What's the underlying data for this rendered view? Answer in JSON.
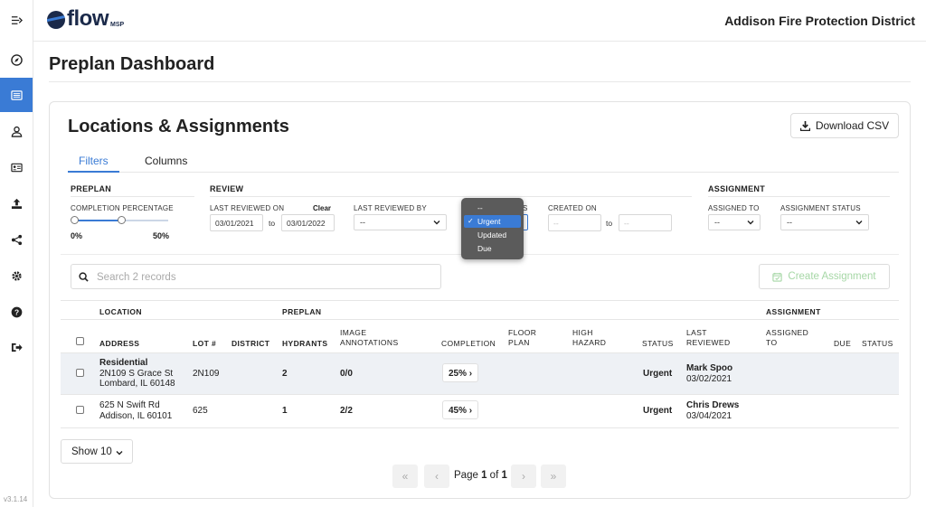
{
  "app": {
    "logo_text": "flow",
    "logo_sub": "MSP",
    "org_name": "Addison Fire Protection District",
    "version": "v3.1.14"
  },
  "sidebar": {
    "items": [
      {
        "icon": "collapse-icon"
      },
      {
        "icon": "compass-icon"
      },
      {
        "icon": "list-icon",
        "active": true
      },
      {
        "icon": "user-icon"
      },
      {
        "icon": "id-card-icon"
      },
      {
        "icon": "upload-icon"
      },
      {
        "icon": "share-icon"
      },
      {
        "icon": "gear-icon"
      },
      {
        "icon": "help-icon"
      },
      {
        "icon": "logout-icon"
      }
    ]
  },
  "page": {
    "title": "Preplan Dashboard"
  },
  "card": {
    "title": "Locations & Assignments",
    "download_label": "Download CSV",
    "tabs": [
      {
        "label": "Filters",
        "active": true
      },
      {
        "label": "Columns",
        "active": false
      }
    ]
  },
  "filters": {
    "preplan": {
      "heading": "PREPLAN",
      "completion_label": "COMPLETION PERCENTAGE",
      "completion_min": "0%",
      "completion_max": "50%",
      "completion_min_value": 0,
      "completion_max_value": 50
    },
    "review": {
      "heading": "REVIEW",
      "last_reviewed_on_label": "LAST REVIEWED ON",
      "clear_label": "Clear",
      "from_date": "03/01/2021",
      "to_label": "to",
      "to_date": "03/01/2022",
      "last_reviewed_by_label": "LAST REVIEWED BY",
      "last_reviewed_by_value": "--",
      "status_label_fragment": "S",
      "created_on_label": "CREATED ON",
      "created_from": "--",
      "created_to": "--"
    },
    "assignment": {
      "heading": "ASSIGNMENT",
      "assigned_to_label": "ASSIGNED TO",
      "assigned_to_value": "--",
      "assignment_status_label": "ASSIGNMENT STATUS",
      "assignment_status_value": "--"
    },
    "status_menu": {
      "options": [
        "--",
        "Urgent",
        "Updated",
        "Due"
      ],
      "selected": "Urgent",
      "check": "✓"
    }
  },
  "toolbar": {
    "search_placeholder": "Search 2 records",
    "create_label": "Create Assignment"
  },
  "table": {
    "groups": {
      "location": "LOCATION",
      "preplan": "PREPLAN",
      "assignment": "ASSIGNMENT"
    },
    "headers": {
      "address": "ADDRESS",
      "lot": "LOT #",
      "district": "DISTRICT",
      "hydrants": "HYDRANTS",
      "image_annotations": [
        "IMAGE",
        "ANNOTATIONS"
      ],
      "completion": "COMPLETION",
      "floor_plan": [
        "FLOOR",
        "PLAN"
      ],
      "high_hazard": [
        "HIGH",
        "HAZARD"
      ],
      "status": "STATUS",
      "last_reviewed": [
        "LAST",
        "REVIEWED"
      ],
      "assigned_to": [
        "ASSIGNED",
        "TO"
      ],
      "due": "DUE",
      "assignment_status": "STATUS"
    },
    "rows": [
      {
        "address_name": "Residential",
        "address_line1": "2N109 S Grace St",
        "address_line2": "Lombard, IL 60148",
        "lot": "2N109",
        "hydrants": "2",
        "image_annotations": "0/0",
        "completion": "25%",
        "status": "Urgent",
        "reviewer": "Mark Spoo",
        "reviewed_date": "03/02/2021"
      },
      {
        "address_line1": "625 N Swift Rd",
        "address_line2": "Addison, IL 60101",
        "lot": "625",
        "hydrants": "1",
        "image_annotations": "2/2",
        "completion": "45%",
        "status": "Urgent",
        "reviewer": "Chris Drews",
        "reviewed_date": "03/04/2021"
      }
    ]
  },
  "pagination": {
    "show_label": "Show 10",
    "page_word": "Page",
    "current": "1",
    "of_word": "of",
    "total": "1",
    "first": "«",
    "prev": "‹",
    "next": "›",
    "last": "»"
  }
}
